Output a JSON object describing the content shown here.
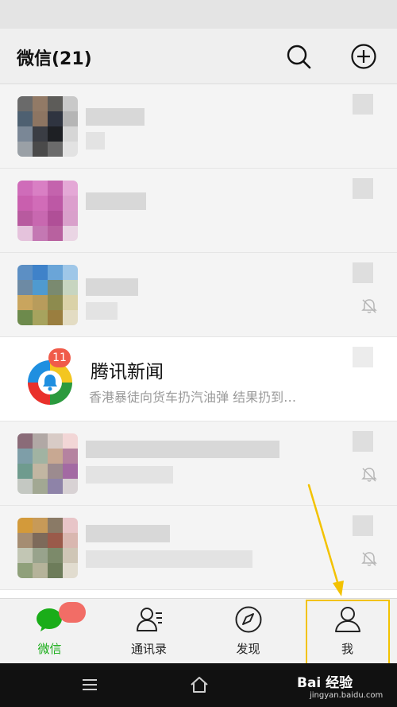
{
  "header": {
    "title": "微信(21)",
    "icons": [
      "search-icon",
      "add-icon"
    ]
  },
  "chats": [
    {
      "name": "",
      "preview": "",
      "obscured": true
    },
    {
      "name": "",
      "preview": "",
      "obscured": true
    },
    {
      "name": "",
      "preview": "",
      "obscured": true,
      "muted": true
    },
    {
      "name": "腾讯新闻",
      "preview": "香港暴徒向货车扔汽油弹 结果扔到…",
      "unread": "11",
      "icon": "tencent-news-logo"
    },
    {
      "name": "",
      "preview": "",
      "obscured": true,
      "muted": true
    },
    {
      "name": "",
      "preview": "",
      "obscured": true,
      "muted": true
    }
  ],
  "tabs": [
    {
      "label": "微信",
      "icon": "chat-bubble-icon",
      "active": true
    },
    {
      "label": "通讯录",
      "icon": "contacts-icon",
      "active": false
    },
    {
      "label": "发现",
      "icon": "compass-icon",
      "active": false
    },
    {
      "label": "我",
      "icon": "person-icon",
      "active": false
    }
  ],
  "watermark": {
    "text": "Bai 经验",
    "sub": "jingyan.baidu.com"
  },
  "colors": {
    "accent_green": "#1aad19",
    "badge_red": "#f05b4a",
    "highlight_yellow": "#f3c200"
  }
}
